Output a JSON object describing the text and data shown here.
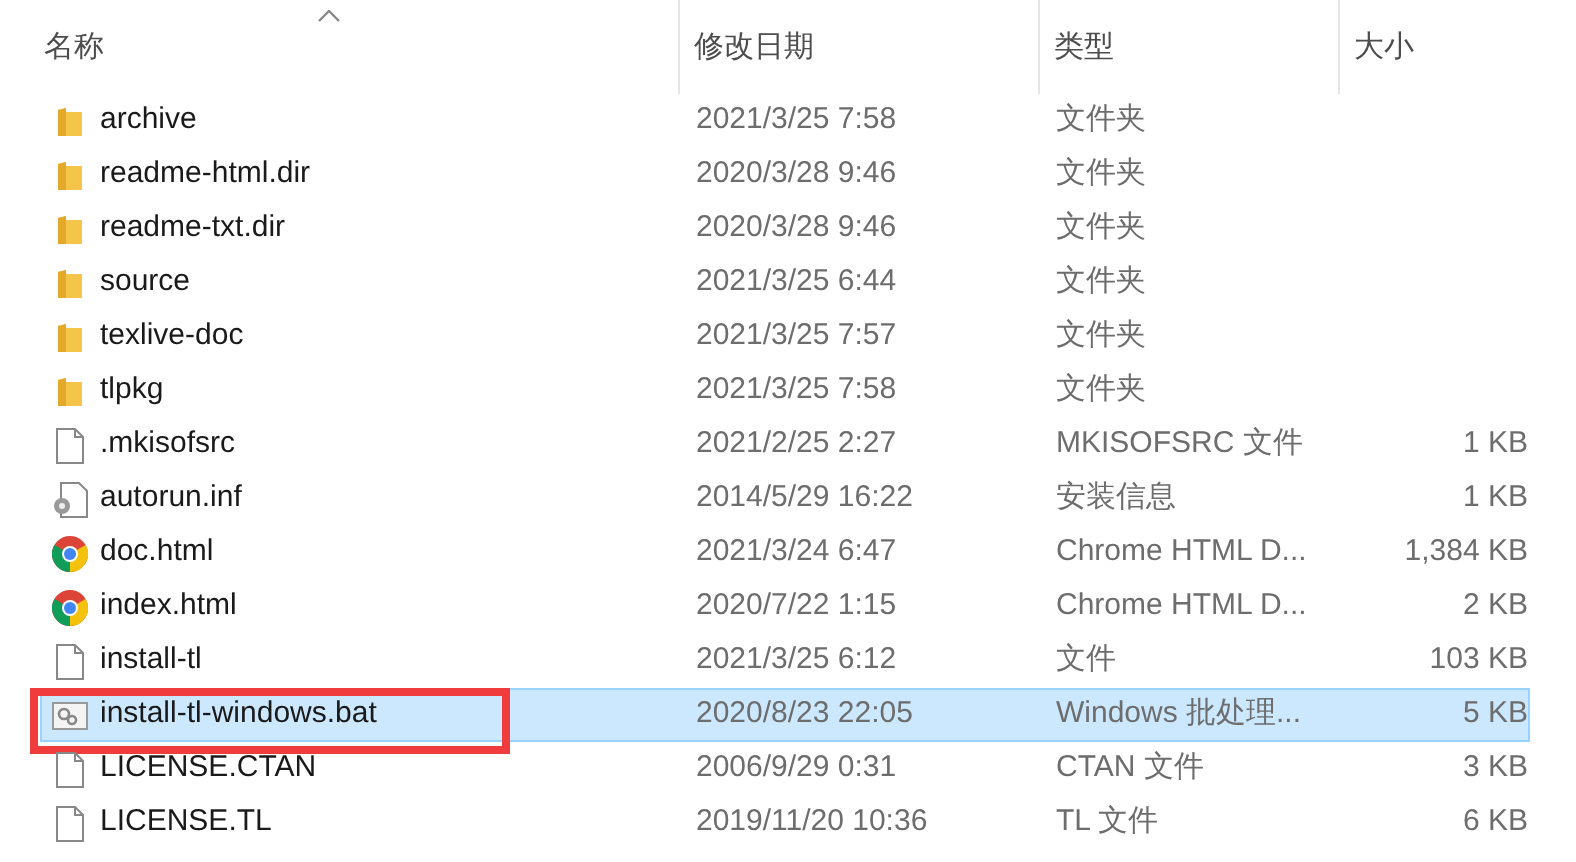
{
  "columns": [
    {
      "label": "名称",
      "sorted": true
    },
    {
      "label": "修改日期",
      "sorted": false
    },
    {
      "label": "类型",
      "sorted": false
    },
    {
      "label": "大小",
      "sorted": false
    }
  ],
  "rows": [
    {
      "kind": "folder",
      "name": "archive",
      "modified": "2021/3/25 7:58",
      "type": "文件夹",
      "selected": false,
      "outlined": false
    },
    {
      "kind": "folder",
      "name": "readme-html.dir",
      "modified": "2020/3/28 9:46",
      "type": "文件夹",
      "selected": false,
      "outlined": false
    },
    {
      "kind": "folder",
      "name": "readme-txt.dir",
      "modified": "2020/3/28 9:46",
      "type": "文件夹",
      "selected": false,
      "outlined": false
    },
    {
      "kind": "folder",
      "name": "source",
      "modified": "2021/3/25 6:44",
      "type": "文件夹",
      "selected": false,
      "outlined": false
    },
    {
      "kind": "folder",
      "name": "texlive-doc",
      "modified": "2021/3/25 7:57",
      "type": "文件夹",
      "selected": false,
      "outlined": false
    },
    {
      "kind": "folder",
      "name": "tlpkg",
      "modified": "2021/3/25 7:58",
      "type": "文件夹",
      "selected": false,
      "outlined": false
    },
    {
      "kind": "file",
      "name": ".mkisofsrc",
      "modified": "2021/2/25 2:27",
      "type": "MKISOFSRC 文件",
      "size": "1 KB",
      "selected": false,
      "outlined": false
    },
    {
      "kind": "setup",
      "name": "autorun.inf",
      "modified": "2014/5/29 16:22",
      "type": "安装信息",
      "size": "1 KB",
      "selected": false,
      "outlined": false
    },
    {
      "kind": "browser",
      "name": "doc.html",
      "modified": "2021/3/24 6:47",
      "type": "Chrome HTML D...",
      "size": "1,384 KB",
      "selected": false,
      "outlined": false
    },
    {
      "kind": "browser",
      "name": "index.html",
      "modified": "2020/7/22 1:15",
      "type": "Chrome HTML D...",
      "size": "2 KB",
      "selected": false,
      "outlined": false
    },
    {
      "kind": "file",
      "name": "install-tl",
      "modified": "2021/3/25 6:12",
      "type": "文件",
      "size": "103 KB",
      "selected": false,
      "outlined": false
    },
    {
      "kind": "batch",
      "name": "install-tl-windows.bat",
      "modified": "2020/8/23 22:05",
      "type": "Windows 批处理...",
      "size": "5 KB",
      "selected": true,
      "outlined": true
    },
    {
      "kind": "file",
      "name": "LICENSE.CTAN",
      "modified": "2006/9/29 0:31",
      "type": "CTAN 文件",
      "size": "3 KB",
      "selected": false,
      "outlined": false
    },
    {
      "kind": "file",
      "name": "LICENSE.TL",
      "modified": "2019/11/20 10:36",
      "type": "TL 文件",
      "size": "6 KB",
      "selected": false,
      "outlined": false
    }
  ]
}
